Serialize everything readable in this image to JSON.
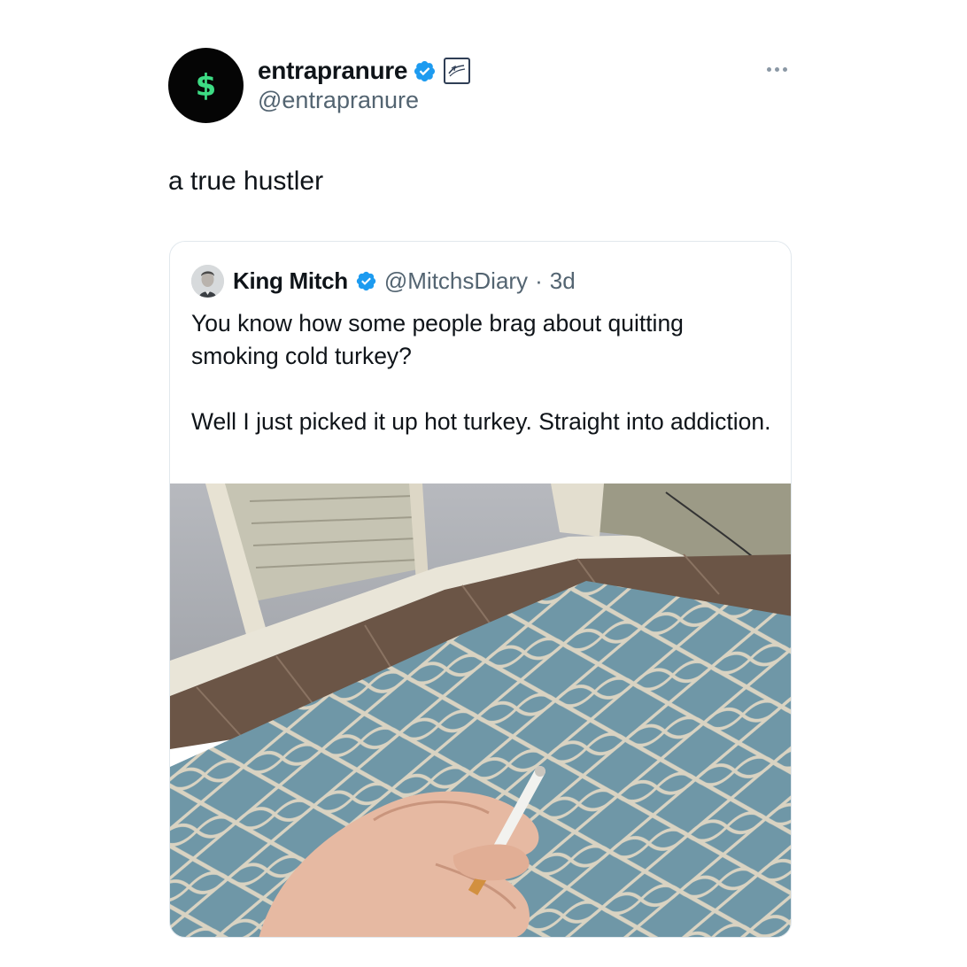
{
  "author": {
    "avatar_symbol": "$",
    "display_name": "entrapranure",
    "handle": "@entrapranure",
    "verified_icon": "verified-badge-icon",
    "affiliate_icon": "affiliate-badge-icon"
  },
  "tweet": {
    "text": "a true hustler"
  },
  "quoted": {
    "display_name": "King Mitch",
    "handle": "@MitchsDiary",
    "separator": "·",
    "time": "3d",
    "paragraphs": [
      "You know how some people brag about quitting smoking cold turkey?",
      "Well I just picked it up hot turkey. Straight into addiction."
    ]
  },
  "colors": {
    "verified_blue": "#1d9bf0",
    "avatar_bg": "#050505",
    "dollar_green": "#3ddc84",
    "secondary_text": "#536471",
    "rug_blue": "#6f97a7"
  }
}
